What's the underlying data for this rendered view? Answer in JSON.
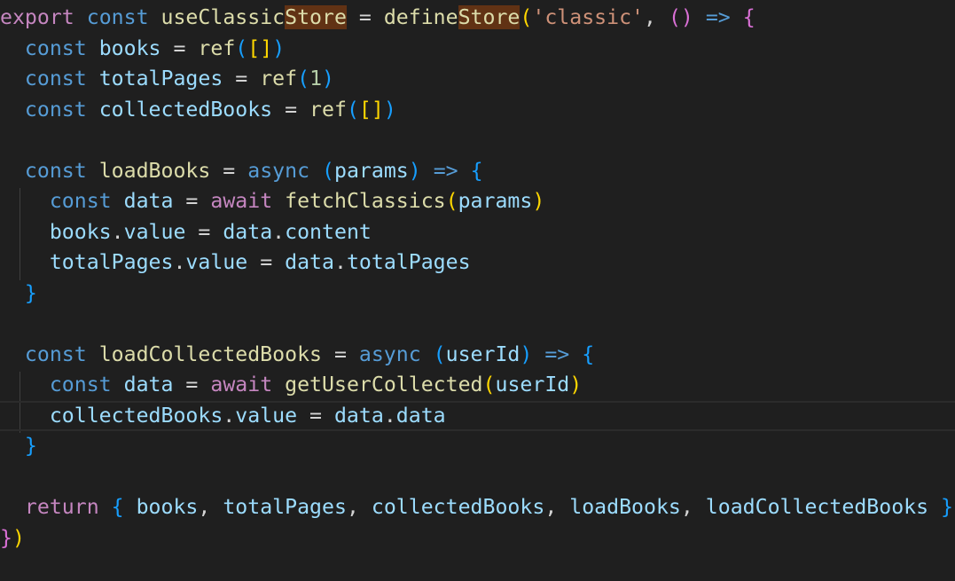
{
  "editor": {
    "colors": {
      "background": "#1f1f1f",
      "keyword": "#569cd6",
      "control": "#c586c0",
      "variable": "#9cdcfe",
      "function": "#dcdcaa",
      "string": "#ce9178",
      "number": "#b5cea8",
      "punctuation": "#d4d4d4",
      "bracket1": "#ffd700",
      "bracket2": "#da70d6",
      "bracket3": "#179fff",
      "match_highlight": "#613214"
    },
    "current_line": 13,
    "lines": [
      [
        [
          "export",
          "control"
        ],
        [
          " ",
          "p"
        ],
        [
          "const",
          "keyword"
        ],
        [
          " ",
          "p"
        ],
        [
          "useClassic",
          "function"
        ],
        [
          "Store",
          "function",
          "hl"
        ],
        [
          " = ",
          "p"
        ],
        [
          "define",
          "function"
        ],
        [
          "Store",
          "function",
          "hl"
        ],
        [
          "(",
          "bracket1"
        ],
        [
          "'classic'",
          "string"
        ],
        [
          ", ",
          "p"
        ],
        [
          "()",
          "bracket2"
        ],
        [
          " ",
          "p"
        ],
        [
          "=>",
          "keyword"
        ],
        [
          " ",
          "p"
        ],
        [
          "{",
          "bracket2"
        ]
      ],
      [
        [
          "  ",
          "p"
        ],
        [
          "const",
          "keyword"
        ],
        [
          " ",
          "p"
        ],
        [
          "books",
          "variable"
        ],
        [
          " = ",
          "p"
        ],
        [
          "ref",
          "function"
        ],
        [
          "(",
          "bracket3"
        ],
        [
          "[]",
          "bracket1"
        ],
        [
          ")",
          "bracket3"
        ]
      ],
      [
        [
          "  ",
          "p"
        ],
        [
          "const",
          "keyword"
        ],
        [
          " ",
          "p"
        ],
        [
          "totalPages",
          "variable"
        ],
        [
          " = ",
          "p"
        ],
        [
          "ref",
          "function"
        ],
        [
          "(",
          "bracket3"
        ],
        [
          "1",
          "number"
        ],
        [
          ")",
          "bracket3"
        ]
      ],
      [
        [
          "  ",
          "p"
        ],
        [
          "const",
          "keyword"
        ],
        [
          " ",
          "p"
        ],
        [
          "collectedBooks",
          "variable"
        ],
        [
          " = ",
          "p"
        ],
        [
          "ref",
          "function"
        ],
        [
          "(",
          "bracket3"
        ],
        [
          "[]",
          "bracket1"
        ],
        [
          ")",
          "bracket3"
        ]
      ],
      [],
      [
        [
          "  ",
          "p"
        ],
        [
          "const",
          "keyword"
        ],
        [
          " ",
          "p"
        ],
        [
          "loadBooks",
          "function"
        ],
        [
          " = ",
          "p"
        ],
        [
          "async",
          "keyword"
        ],
        [
          " ",
          "p"
        ],
        [
          "(",
          "bracket3"
        ],
        [
          "params",
          "variable"
        ],
        [
          ")",
          "bracket3"
        ],
        [
          " ",
          "p"
        ],
        [
          "=>",
          "keyword"
        ],
        [
          " ",
          "p"
        ],
        [
          "{",
          "bracket3"
        ]
      ],
      [
        [
          "    ",
          "p"
        ],
        [
          "const",
          "keyword"
        ],
        [
          " ",
          "p"
        ],
        [
          "data",
          "variable"
        ],
        [
          " = ",
          "p"
        ],
        [
          "await",
          "control"
        ],
        [
          " ",
          "p"
        ],
        [
          "fetchClassics",
          "function"
        ],
        [
          "(",
          "bracket1"
        ],
        [
          "params",
          "variable"
        ],
        [
          ")",
          "bracket1"
        ]
      ],
      [
        [
          "    ",
          "p"
        ],
        [
          "books",
          "variable"
        ],
        [
          ".",
          "p"
        ],
        [
          "value",
          "variable"
        ],
        [
          " = ",
          "p"
        ],
        [
          "data",
          "variable"
        ],
        [
          ".",
          "p"
        ],
        [
          "content",
          "variable"
        ]
      ],
      [
        [
          "    ",
          "p"
        ],
        [
          "totalPages",
          "variable"
        ],
        [
          ".",
          "p"
        ],
        [
          "value",
          "variable"
        ],
        [
          " = ",
          "p"
        ],
        [
          "data",
          "variable"
        ],
        [
          ".",
          "p"
        ],
        [
          "totalPages",
          "variable"
        ]
      ],
      [
        [
          "  ",
          "p"
        ],
        [
          "}",
          "bracket3"
        ]
      ],
      [],
      [
        [
          "  ",
          "p"
        ],
        [
          "const",
          "keyword"
        ],
        [
          " ",
          "p"
        ],
        [
          "loadCollectedBooks",
          "function"
        ],
        [
          " = ",
          "p"
        ],
        [
          "async",
          "keyword"
        ],
        [
          " ",
          "p"
        ],
        [
          "(",
          "bracket3"
        ],
        [
          "userId",
          "variable"
        ],
        [
          ")",
          "bracket3"
        ],
        [
          " ",
          "p"
        ],
        [
          "=>",
          "keyword"
        ],
        [
          " ",
          "p"
        ],
        [
          "{",
          "bracket3"
        ]
      ],
      [
        [
          "    ",
          "p"
        ],
        [
          "const",
          "keyword"
        ],
        [
          " ",
          "p"
        ],
        [
          "data",
          "variable"
        ],
        [
          " = ",
          "p"
        ],
        [
          "await",
          "control"
        ],
        [
          " ",
          "p"
        ],
        [
          "getUserCollected",
          "function"
        ],
        [
          "(",
          "bracket1"
        ],
        [
          "userId",
          "variable"
        ],
        [
          ")",
          "bracket1"
        ]
      ],
      [
        [
          "    ",
          "p"
        ],
        [
          "collectedBooks",
          "variable"
        ],
        [
          ".",
          "p"
        ],
        [
          "value",
          "variable"
        ],
        [
          " = ",
          "p"
        ],
        [
          "data",
          "variable"
        ],
        [
          ".",
          "p"
        ],
        [
          "data",
          "variable"
        ]
      ],
      [
        [
          "  ",
          "p"
        ],
        [
          "}",
          "bracket3"
        ]
      ],
      [],
      [
        [
          "  ",
          "p"
        ],
        [
          "return",
          "control"
        ],
        [
          " ",
          "p"
        ],
        [
          "{",
          "bracket3"
        ],
        [
          " ",
          "p"
        ],
        [
          "books",
          "variable"
        ],
        [
          ", ",
          "p"
        ],
        [
          "totalPages",
          "variable"
        ],
        [
          ", ",
          "p"
        ],
        [
          "collectedBooks",
          "variable"
        ],
        [
          ", ",
          "p"
        ],
        [
          "loadBooks",
          "variable"
        ],
        [
          ", ",
          "p"
        ],
        [
          "loadCollectedBooks",
          "variable"
        ],
        [
          " ",
          "p"
        ],
        [
          "}",
          "bracket3"
        ]
      ],
      [
        [
          "}",
          "bracket2"
        ],
        [
          ")",
          "bracket1"
        ]
      ]
    ]
  }
}
